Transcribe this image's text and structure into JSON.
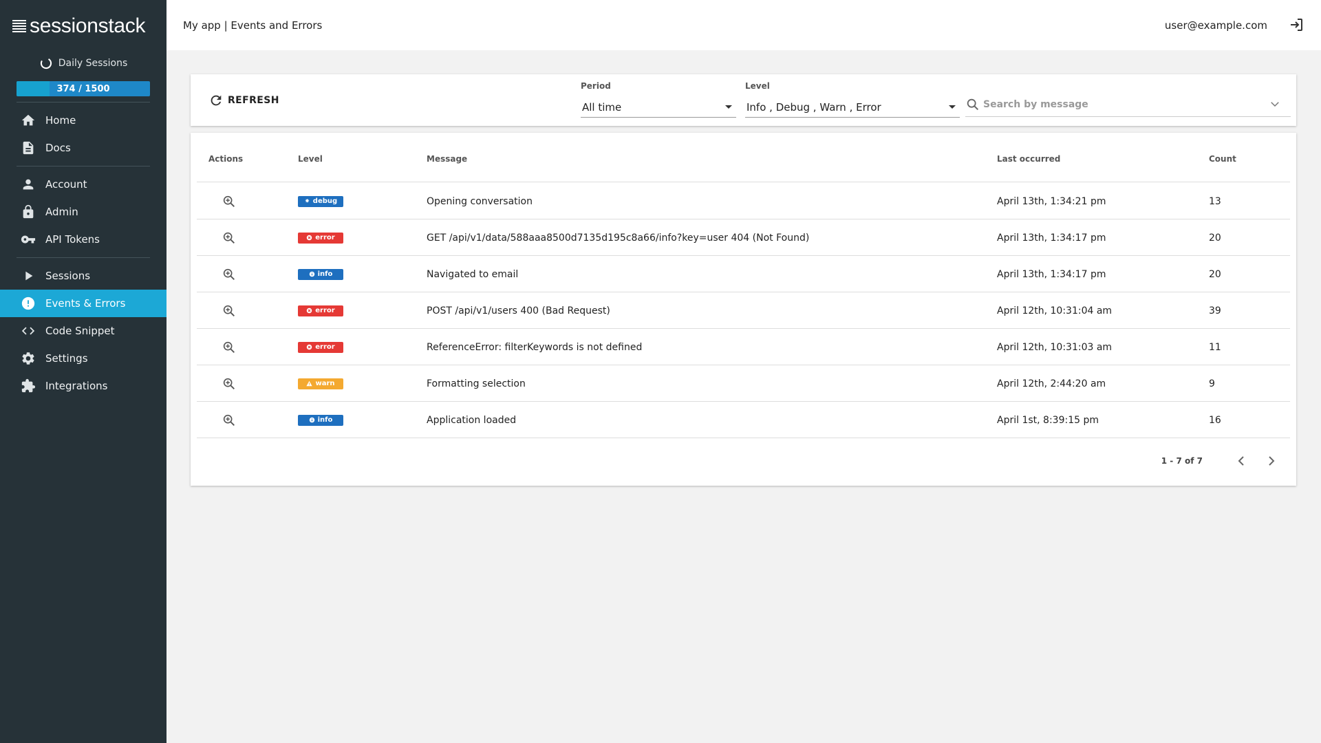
{
  "sidebar": {
    "logo_text": "sessionstack",
    "daily_sessions_label": "Daily Sessions",
    "quota_text": "374 / 1500",
    "quota_fraction": 0.249,
    "groups": [
      [
        {
          "label": "Home",
          "icon": "home-icon"
        },
        {
          "label": "Docs",
          "icon": "document-icon"
        }
      ],
      [
        {
          "label": "Account",
          "icon": "person-icon"
        },
        {
          "label": "Admin",
          "icon": "lock-icon"
        },
        {
          "label": "API Tokens",
          "icon": "key-icon"
        }
      ],
      [
        {
          "label": "Sessions",
          "icon": "play-icon"
        },
        {
          "label": "Events & Errors",
          "icon": "alert-circle-icon",
          "active": true
        },
        {
          "label": "Code Snippet",
          "icon": "code-icon"
        },
        {
          "label": "Settings",
          "icon": "gear-icon"
        },
        {
          "label": "Integrations",
          "icon": "puzzle-icon"
        }
      ]
    ]
  },
  "header": {
    "title": "My app | Events and Errors",
    "user": "user@example.com"
  },
  "filters": {
    "refresh_label": "REFRESH",
    "period_label": "Period",
    "period_value": "All time",
    "level_label": "Level",
    "level_value": "Info , Debug , Warn , Error",
    "search_placeholder": "Search by message"
  },
  "table": {
    "headers": {
      "actions": "Actions",
      "level": "Level",
      "message": "Message",
      "last_occurred": "Last occurred",
      "count": "Count"
    },
    "rows": [
      {
        "level": "debug",
        "message": "Opening conversation",
        "last_occurred": "April 13th, 1:34:21 pm",
        "count": "13"
      },
      {
        "level": "error",
        "message": "GET /api/v1/data/588aaa8500d7135d195c8a66/info?key=user 404 (Not Found)",
        "last_occurred": "April 13th, 1:34:17 pm",
        "count": "20"
      },
      {
        "level": "info",
        "message": "Navigated to email",
        "last_occurred": "April 13th, 1:34:17 pm",
        "count": "20"
      },
      {
        "level": "error",
        "message": "POST /api/v1/users 400 (Bad Request)",
        "last_occurred": "April 12th, 10:31:04 am",
        "count": "39"
      },
      {
        "level": "error",
        "message": "ReferenceError: filterKeywords is not defined",
        "last_occurred": "April 12th, 10:31:03 am",
        "count": "11"
      },
      {
        "level": "warn",
        "message": "Formatting selection",
        "last_occurred": "April 12th, 2:44:20 am",
        "count": "9"
      },
      {
        "level": "info",
        "message": "Application loaded",
        "last_occurred": "April 1st, 8:39:15 pm",
        "count": "16"
      }
    ],
    "pagination": "1 - 7 of 7"
  },
  "colors": {
    "sidebar_bg": "#263238",
    "active_item": "#1ca8d6",
    "debug": "#1e6fbf",
    "error": "#e53935",
    "info": "#1e6fbf",
    "warn": "#f4a930"
  }
}
